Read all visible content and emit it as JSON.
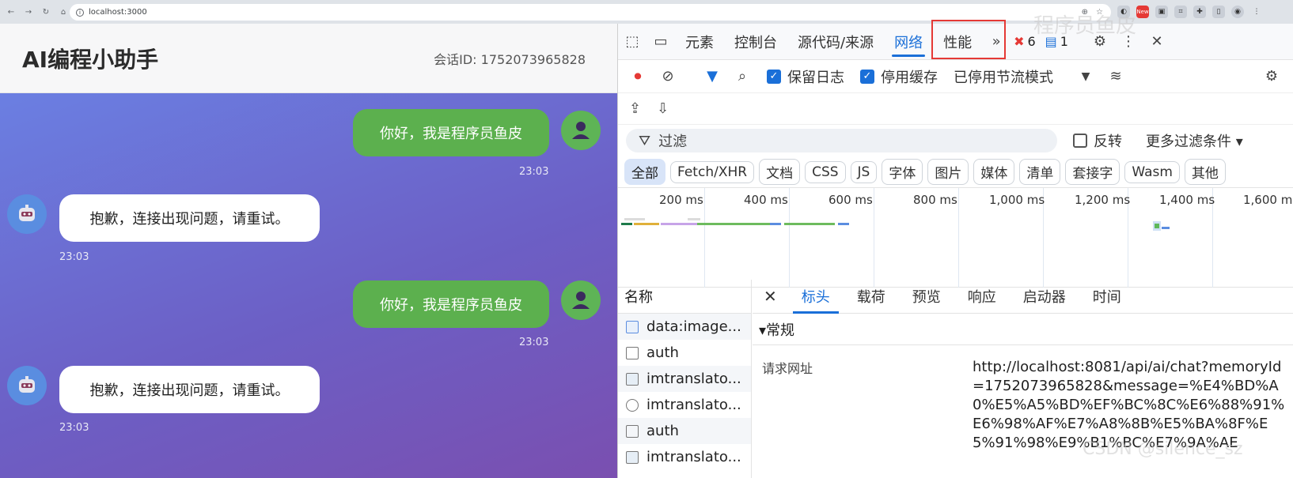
{
  "browser": {
    "url": "localhost:3000",
    "ext_badge": "New"
  },
  "app": {
    "title": "AI编程小助手",
    "session_label": "会话ID: 1752073965828",
    "messages": [
      {
        "role": "user",
        "text": "你好，我是程序员鱼皮",
        "time": "23:03"
      },
      {
        "role": "bot",
        "text": "抱歉，连接出现问题，请重试。",
        "time": "23:03"
      },
      {
        "role": "user",
        "text": "你好，我是程序员鱼皮",
        "time": "23:03"
      },
      {
        "role": "bot",
        "text": "抱歉，连接出现问题，请重试。",
        "time": "23:03"
      }
    ]
  },
  "devtools": {
    "tabs": [
      "元素",
      "控制台",
      "源代码/来源",
      "网络",
      "性能"
    ],
    "active_tab": "网络",
    "error_count": "6",
    "message_count": "1",
    "toolbar": {
      "preserve_log": "保留日志",
      "disable_cache": "停用缓存",
      "throttle": "已停用节流模式"
    },
    "filter": {
      "placeholder": "过滤",
      "invert": "反转",
      "more_filters": "更多过滤条件"
    },
    "chips": [
      "全部",
      "Fetch/XHR",
      "文档",
      "CSS",
      "JS",
      "字体",
      "图片",
      "媒体",
      "清单",
      "套接字",
      "Wasm",
      "其他"
    ],
    "timeline_ticks": [
      "200 ms",
      "400 ms",
      "600 ms",
      "800 ms",
      "1,000 ms",
      "1,200 ms",
      "1,400 ms",
      "1,600 m"
    ],
    "names_header": "名称",
    "requests": [
      "data:image...",
      "auth",
      "imtranslato...",
      "imtranslato...",
      "auth",
      "imtranslato..."
    ],
    "detail_tabs": [
      "标头",
      "载荷",
      "预览",
      "响应",
      "启动器",
      "时间"
    ],
    "active_detail_tab": "标头",
    "section": "▾常规",
    "request_url_label": "请求网址",
    "request_url": "http://localhost:8081/api/ai/chat?memoryId=1752073965828&message=%E4%BD%A0%E5%A5%BD%EF%BC%8C%E6%88%91%E6%98%AF%E7%A8%8B%E5%BA%8F%E5%91%98%E9%B1%BC%E7%9A%AE"
  },
  "watermarks": {
    "top": "程序员鱼皮",
    "bottom": "CSDN @silence_sz"
  },
  "colors": {
    "user_bubble": "#5cb04e",
    "bot_bubble": "#ffffff",
    "accent_blue": "#1a6fd8",
    "highlight_red": "#e53935"
  }
}
